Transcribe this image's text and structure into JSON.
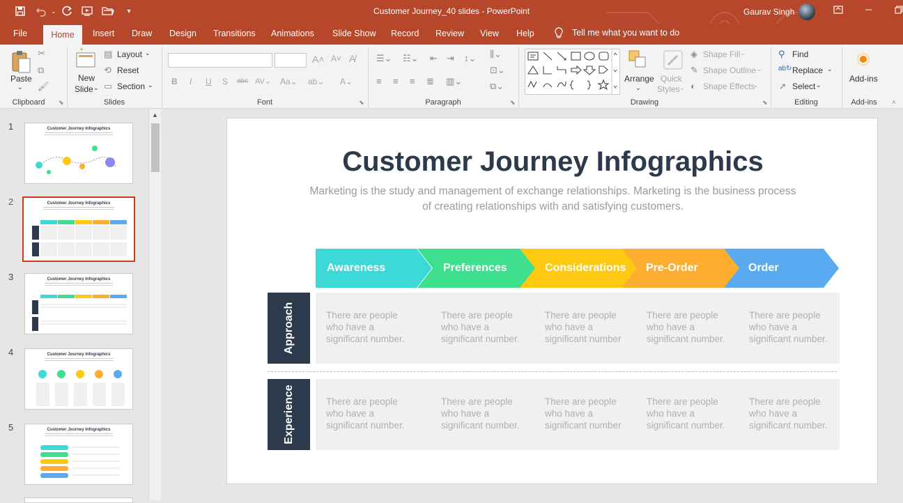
{
  "window": {
    "title": "Customer Journey_40 slides  -  PowerPoint",
    "user": "Gaurav Singh"
  },
  "tabs": [
    "File",
    "Home",
    "Insert",
    "Draw",
    "Design",
    "Transitions",
    "Animations",
    "Slide Show",
    "Record",
    "Review",
    "View",
    "Help"
  ],
  "tellme": "Tell me what you want to do",
  "ribbon": {
    "clipboard": {
      "label": "Clipboard",
      "paste": "Paste"
    },
    "slides": {
      "label": "Slides",
      "new_slide_1": "New",
      "new_slide_2": "Slide",
      "layout": "Layout",
      "reset": "Reset",
      "section": "Section"
    },
    "font": {
      "label": "Font"
    },
    "paragraph": {
      "label": "Paragraph"
    },
    "drawing": {
      "label": "Drawing",
      "arrange": "Arrange",
      "quick_styles_1": "Quick",
      "quick_styles_2": "Styles",
      "shape_fill": "Shape Fill",
      "shape_outline": "Shape Outline",
      "shape_effects": "Shape Effects"
    },
    "editing": {
      "label": "Editing",
      "find": "Find",
      "replace": "Replace",
      "select": "Select"
    },
    "addins": {
      "label": "Add-ins",
      "button": "Add-ins"
    }
  },
  "thumbnails": {
    "numbers": [
      "1",
      "2",
      "3",
      "4",
      "5"
    ],
    "title": "Customer Journey Infographics",
    "active_index": 2
  },
  "slide": {
    "title": "Customer Journey Infographics",
    "subtitle": "Marketing is the study and management of exchange relationships. Marketing is the business process of creating relationships with and satisfying customers.",
    "stages": [
      {
        "label": "Awareness",
        "color": "#3dd9d6"
      },
      {
        "label": "Preferences",
        "color": "#3ee08e"
      },
      {
        "label": "Considerations",
        "color": "#fdc911"
      },
      {
        "label": "Pre-Order",
        "color": "#fdad30"
      },
      {
        "label": "Order",
        "color": "#5aaaf2"
      }
    ],
    "rows": [
      {
        "label": "Approach",
        "cells": [
          "There are people who have a significant number.",
          "There are people who have a significant number.",
          "There are people who have a significant number.",
          "There are people who have a significant number.",
          "There are people who have a significant number."
        ]
      },
      {
        "label": "Experience",
        "cells": [
          "There are people who have a significant number.",
          "There are people who have a significant number.",
          "There are people who have a significant number.",
          "There are people who have a significant number.",
          "There are people who have a significant number."
        ]
      }
    ]
  },
  "colors": {
    "accent": "#b7472a",
    "dark_navy": "#2d3a4b",
    "cell_grey": "#f0f0f0"
  }
}
